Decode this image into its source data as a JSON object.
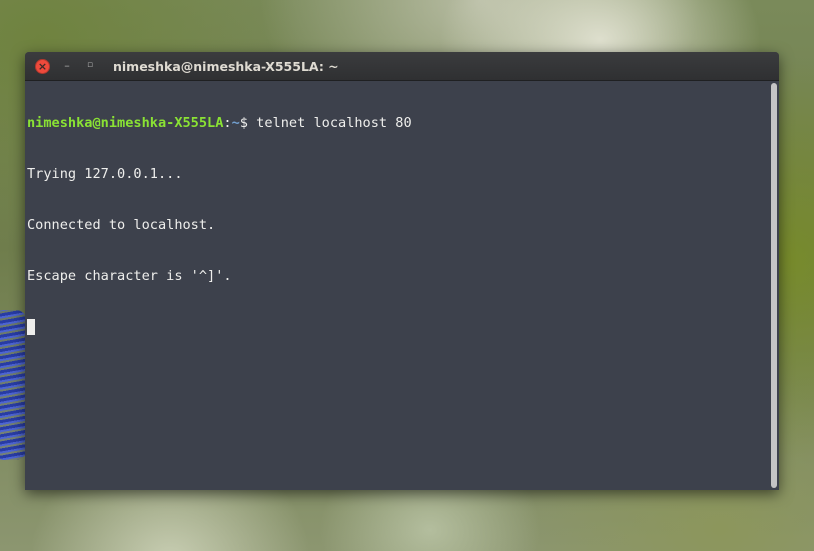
{
  "window": {
    "title": "nimeshka@nimeshka-X555LA: ~",
    "buttons": {
      "close": "×",
      "minimize": "–",
      "maximize": "▫"
    }
  },
  "terminal": {
    "prompt": {
      "user_host": "nimeshka@nimeshka-X555LA",
      "separator": ":",
      "path": "~",
      "symbol": "$",
      "command": " telnet localhost 80"
    },
    "output": [
      "Trying 127.0.0.1...",
      "Connected to localhost.",
      "Escape character is '^]'."
    ]
  },
  "colors": {
    "terminal_bg": "#3d414c",
    "prompt_user": "#8ae234",
    "prompt_path": "#729fcf",
    "text": "#eeeeec",
    "close_button": "#ee4a3c"
  }
}
